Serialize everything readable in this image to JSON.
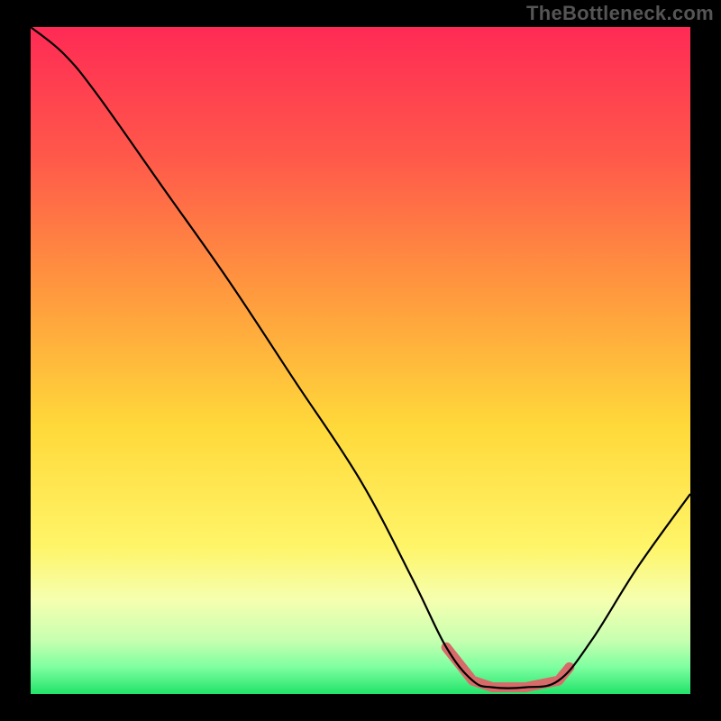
{
  "watermark": "TheBottleneck.com",
  "chart_data": {
    "type": "line",
    "title": "",
    "xlabel": "",
    "ylabel": "",
    "ylim": [
      0,
      100
    ],
    "xlim": [
      0,
      100
    ],
    "curve": {
      "name": "bottleneck-curve",
      "points": [
        {
          "x": 0,
          "y": 100
        },
        {
          "x": 5,
          "y": 96
        },
        {
          "x": 10,
          "y": 90
        },
        {
          "x": 20,
          "y": 76
        },
        {
          "x": 30,
          "y": 62
        },
        {
          "x": 40,
          "y": 47
        },
        {
          "x": 50,
          "y": 32
        },
        {
          "x": 58,
          "y": 17
        },
        {
          "x": 63,
          "y": 7
        },
        {
          "x": 67,
          "y": 2
        },
        {
          "x": 70,
          "y": 1
        },
        {
          "x": 75,
          "y": 1
        },
        {
          "x": 80,
          "y": 2
        },
        {
          "x": 85,
          "y": 8
        },
        {
          "x": 92,
          "y": 19
        },
        {
          "x": 100,
          "y": 30
        }
      ]
    },
    "highlight_band": {
      "x_start": 63,
      "x_end": 82,
      "color": "#d86a6a"
    },
    "background_gradient": {
      "stops": [
        {
          "offset": 0.0,
          "color": "#ff2a55"
        },
        {
          "offset": 0.2,
          "color": "#ff5a4a"
        },
        {
          "offset": 0.4,
          "color": "#ff9a3e"
        },
        {
          "offset": 0.6,
          "color": "#ffd93a"
        },
        {
          "offset": 0.78,
          "color": "#fff569"
        },
        {
          "offset": 0.86,
          "color": "#f5ffb0"
        },
        {
          "offset": 0.92,
          "color": "#c7ffb0"
        },
        {
          "offset": 0.96,
          "color": "#7dffa0"
        },
        {
          "offset": 1.0,
          "color": "#22e36a"
        }
      ]
    }
  }
}
